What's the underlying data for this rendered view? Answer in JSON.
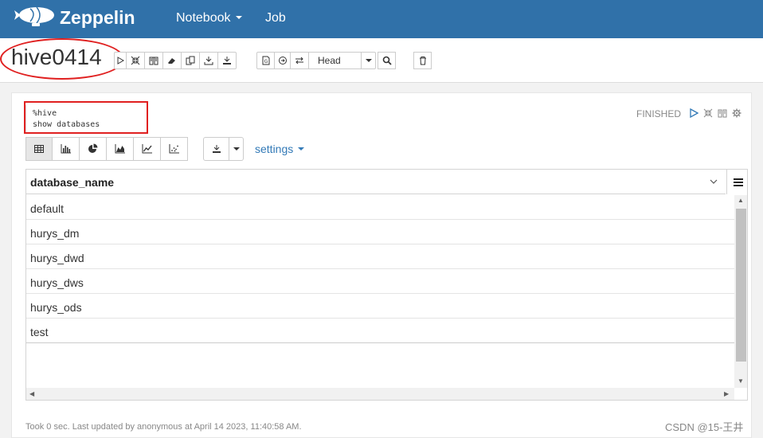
{
  "nav": {
    "brand": "Zeppelin",
    "notebook_label": "Notebook",
    "job_label": "Job"
  },
  "note": {
    "title": "hive0414",
    "mode_label": "Head"
  },
  "paragraph": {
    "code_line1": "%hive",
    "code_line2": "show databases",
    "status": "FINISHED",
    "settings_label": "settings",
    "footer": "Took 0 sec. Last updated by anonymous at April 14 2023, 11:40:58 AM."
  },
  "table": {
    "column": "database_name",
    "rows": [
      "default",
      "hurys_dm",
      "hurys_dwd",
      "hurys_dws",
      "hurys_ods",
      "test"
    ]
  },
  "watermark": "CSDN @15-王井",
  "colors": {
    "navbar": "#3071a9",
    "annotation": "#e02020",
    "link": "#337ab7"
  },
  "icons": [
    "zeppelin-logo",
    "run-icon",
    "collapse-icon",
    "book-icon",
    "eraser-icon",
    "clone-icon",
    "export-icon",
    "download-icon",
    "version-icon",
    "commit-icon",
    "revision-icon",
    "search-icon",
    "trash-icon",
    "table-icon",
    "bar-chart-icon",
    "pie-chart-icon",
    "area-chart-icon",
    "line-chart-icon",
    "scatter-chart-icon",
    "gear-icon",
    "menu-icon",
    "chevron-down-icon"
  ]
}
